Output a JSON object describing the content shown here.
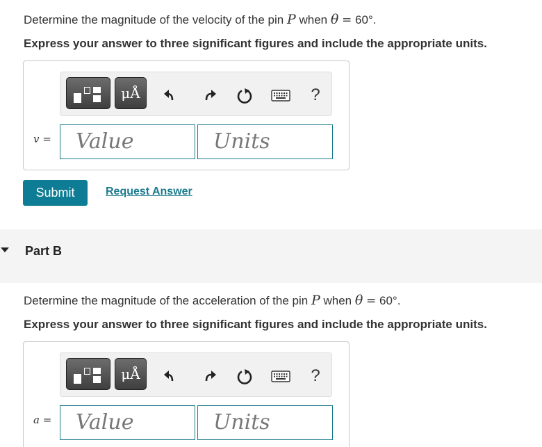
{
  "part_a": {
    "question_prefix": "Determine the magnitude of the velocity of the pin",
    "pin_symbol": "P",
    "when_text": "when",
    "theta_symbol": "θ",
    "equals": "=",
    "angle_value": "60°.",
    "instruction": "Express your answer to three significant figures and include the appropriate units.",
    "variable": "v",
    "variable_eq": "=",
    "value_placeholder": "Value",
    "units_placeholder": "Units",
    "submit_label": "Submit",
    "request_answer_label": "Request Answer"
  },
  "part_b": {
    "title": "Part B",
    "question_prefix": "Determine the magnitude of the acceleration of the pin",
    "pin_symbol": "P",
    "when_text": "when",
    "theta_symbol": "θ",
    "equals": "=",
    "angle_value": "60°.",
    "instruction": "Express your answer to three significant figures and include the appropriate units.",
    "variable": "a",
    "variable_eq": "=",
    "value_placeholder": "Value",
    "units_placeholder": "Units"
  },
  "toolbar": {
    "units_glyph": "μÅ",
    "help_label": "?",
    "icons": [
      "templates-icon",
      "units-icon",
      "undo-icon",
      "redo-icon",
      "reset-icon",
      "keyboard-icon",
      "help-icon"
    ]
  },
  "colors": {
    "accent": "#0e7c94",
    "field_border": "#1a7a8c",
    "band": "#f4f4f4"
  }
}
